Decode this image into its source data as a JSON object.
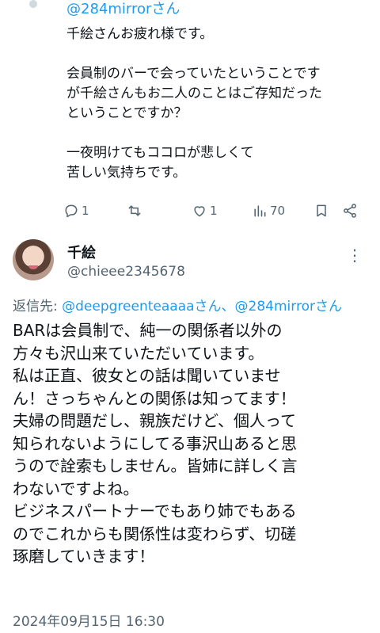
{
  "parent_tweet": {
    "reply_handle": "@284mirrorさん",
    "body": "千絵さんお疲れ様です。\n\n会員制のバーで会っていたということです\nが千絵さんもお二人のことはご存知だった\nということですか？\n\n一夜明けてもココロが悲しくて\n苦しい気持ちです。",
    "actions": {
      "reply_count": "1",
      "retweet_count": "",
      "like_count": "1",
      "view_count": "70"
    }
  },
  "reply_tweet": {
    "display_name": "千絵",
    "handle": "@chieee2345678",
    "more_label": "⋮",
    "reply_to_prefix": "返信先: ",
    "reply_to_mentions": "@deepgreenteaaaaさん、@284mirrorさん",
    "body_lines": [
      "BARは会員制で、純一の関係者以外の",
      "方々も沢山来ていただいています。",
      "私は正直、彼女との話は聞いていませ",
      "ん！さっちゃんとの関係は知ってます！",
      "夫婦の問題だし、親族だけど、個人って",
      "知られないようにしてる事沢山あると思",
      "うので詮索もしません。皆姉に詳しく言",
      "わないですよね。",
      "ビジネスパートナーでもあり姉でもある",
      "のでこれからも関係性は変わらず、切磋",
      "琢磨していきます！"
    ],
    "timestamp": "2024年09月15日 16:30"
  },
  "colors": {
    "accent": "#1d9bf0",
    "muted": "#536471",
    "text": "#0f1419"
  }
}
